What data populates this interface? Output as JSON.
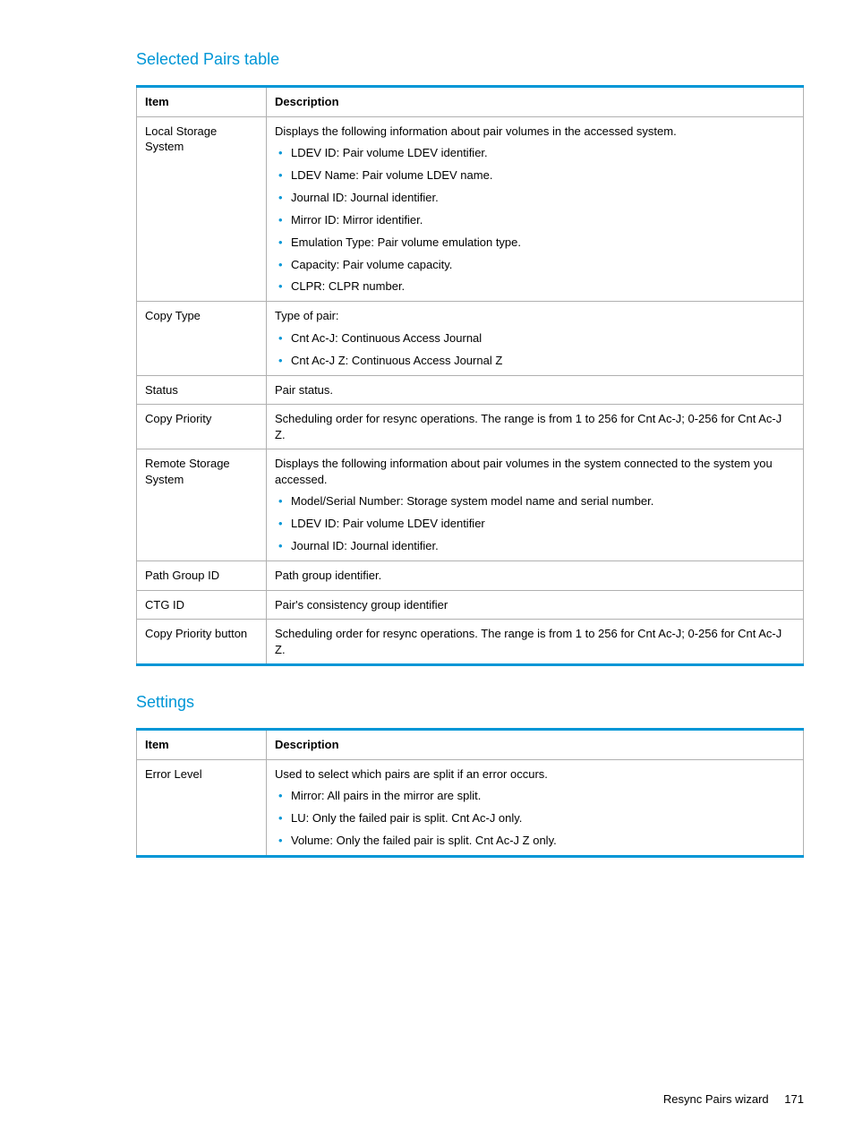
{
  "sections": {
    "selected_pairs": {
      "heading": "Selected Pairs table",
      "header_item": "Item",
      "header_desc": "Description",
      "rows": {
        "local_storage": {
          "item": "Local Storage System",
          "desc_lead": "Displays the following information about pair volumes in the accessed system.",
          "bullets": [
            "LDEV ID: Pair volume LDEV identifier.",
            "LDEV Name: Pair volume LDEV name.",
            "Journal ID: Journal identifier.",
            "Mirror ID: Mirror identifier.",
            "Emulation Type: Pair volume emulation type.",
            "Capacity: Pair volume capacity.",
            "CLPR: CLPR number."
          ]
        },
        "copy_type": {
          "item": "Copy Type",
          "desc_lead": "Type of pair:",
          "bullets": [
            "Cnt Ac-J: Continuous Access Journal",
            "Cnt Ac-J Z: Continuous Access Journal Z"
          ]
        },
        "status": {
          "item": "Status",
          "desc": "Pair status."
        },
        "copy_priority": {
          "item": "Copy Priority",
          "desc": "Scheduling order for resync operations. The range is from 1 to 256 for Cnt Ac-J; 0-256 for Cnt Ac-J Z."
        },
        "remote_storage": {
          "item": "Remote Storage System",
          "desc_lead": "Displays the following information about pair volumes in the system connected to the system you accessed.",
          "bullets": [
            "Model/Serial Number: Storage system model name and serial number.",
            "LDEV ID: Pair volume LDEV identifier",
            "Journal ID: Journal identifier."
          ]
        },
        "path_group": {
          "item": "Path Group ID",
          "desc": "Path group identifier."
        },
        "ctg_id": {
          "item": "CTG ID",
          "desc": "Pair's consistency group identifier"
        },
        "copy_priority_btn": {
          "item": "Copy Priority button",
          "desc": "Scheduling order for resync operations. The range is from 1 to 256 for Cnt Ac-J; 0-256 for Cnt Ac-J Z."
        }
      }
    },
    "settings": {
      "heading": "Settings",
      "header_item": "Item",
      "header_desc": "Description",
      "rows": {
        "error_level": {
          "item": "Error Level",
          "desc_lead": "Used to select which pairs are split if an error occurs.",
          "bullets": [
            "Mirror: All pairs in the mirror are split.",
            "LU: Only the failed pair is split. Cnt Ac-J only.",
            "Volume: Only the failed pair is split. Cnt Ac-J Z only."
          ]
        }
      }
    }
  },
  "footer": {
    "text": "Resync Pairs wizard",
    "page": "171"
  }
}
